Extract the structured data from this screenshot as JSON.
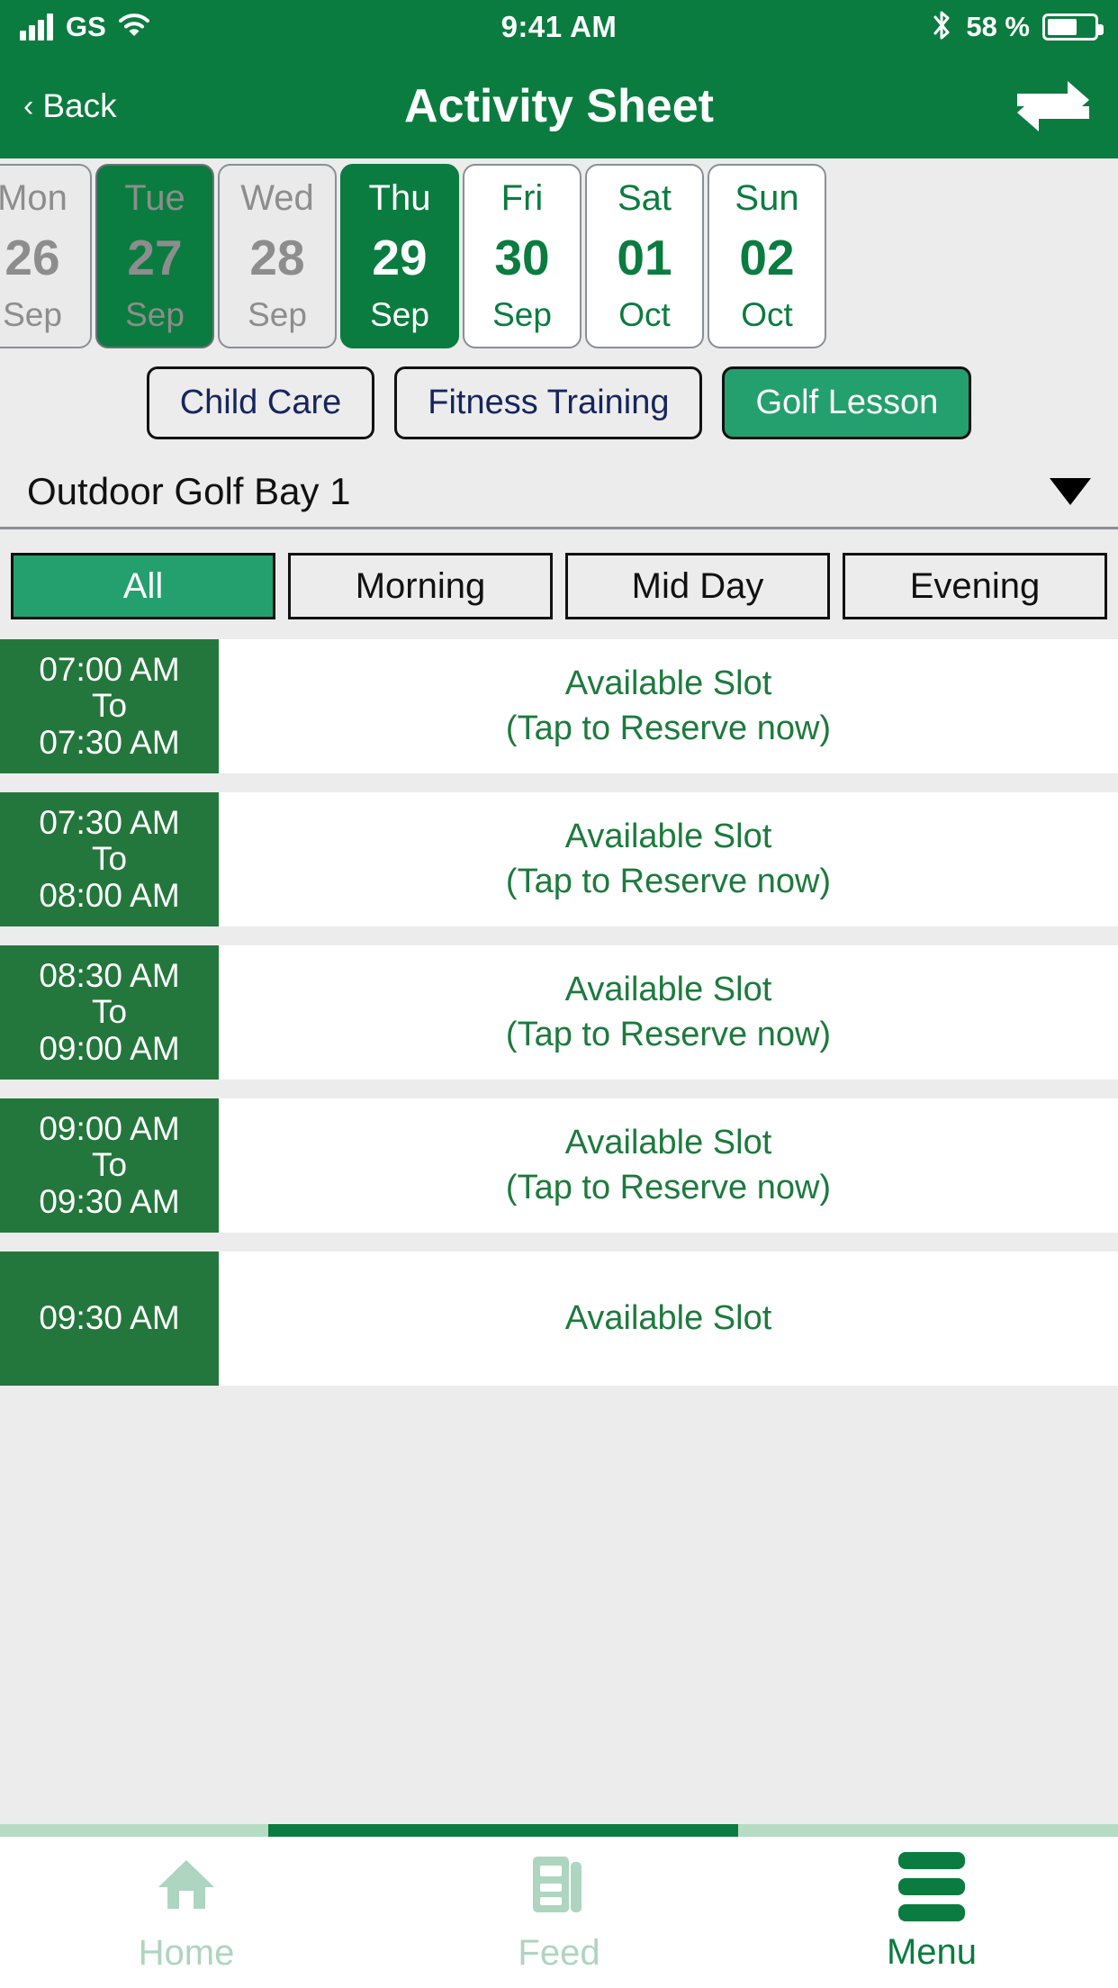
{
  "status_bar": {
    "carrier": "GS",
    "time": "9:41 AM",
    "battery_percent": "58 %",
    "signal_icon": "signal-bars-icon",
    "wifi_icon": "wifi-icon",
    "bluetooth_icon": "bluetooth-icon",
    "battery_icon": "battery-icon"
  },
  "header": {
    "back_label": "Back",
    "title": "Activity Sheet",
    "action_icon": "swap-arrows-icon"
  },
  "dates": [
    {
      "dow": "Mon",
      "day": "26",
      "mon": "Sep",
      "state": "past"
    },
    {
      "dow": "Tue",
      "day": "27",
      "mon": "Sep",
      "state": "past-highlight"
    },
    {
      "dow": "Wed",
      "day": "28",
      "mon": "Sep",
      "state": "past"
    },
    {
      "dow": "Thu",
      "day": "29",
      "mon": "Sep",
      "state": "selected"
    },
    {
      "dow": "Fri",
      "day": "30",
      "mon": "Sep",
      "state": "future"
    },
    {
      "dow": "Sat",
      "day": "01",
      "mon": "Oct",
      "state": "future"
    },
    {
      "dow": "Sun",
      "day": "02",
      "mon": "Oct",
      "state": "future"
    }
  ],
  "activity_types": [
    {
      "label": "Child Care",
      "selected": false
    },
    {
      "label": "Fitness Training",
      "selected": false
    },
    {
      "label": "Golf Lesson",
      "selected": true
    }
  ],
  "location": {
    "selected": "Outdoor Golf Bay 1",
    "caret_icon": "chevron-down-icon"
  },
  "time_filters": [
    {
      "label": "All",
      "selected": true
    },
    {
      "label": "Morning",
      "selected": false
    },
    {
      "label": "Mid Day",
      "selected": false
    },
    {
      "label": "Evening",
      "selected": false
    }
  ],
  "slots": [
    {
      "start": "07:00 AM",
      "sep": "To",
      "end": "07:30 AM",
      "status": "Available Slot",
      "hint": "(Tap to Reserve now)"
    },
    {
      "start": "07:30 AM",
      "sep": "To",
      "end": "08:00 AM",
      "status": "Available Slot",
      "hint": "(Tap to Reserve now)"
    },
    {
      "start": "08:30 AM",
      "sep": "To",
      "end": "09:00 AM",
      "status": "Available Slot",
      "hint": "(Tap to Reserve now)"
    },
    {
      "start": "09:00 AM",
      "sep": "To",
      "end": "09:30 AM",
      "status": "Available Slot",
      "hint": "(Tap to Reserve now)"
    },
    {
      "start": "09:30 AM",
      "sep": "",
      "end": "",
      "status": "Available Slot",
      "hint": ""
    }
  ],
  "bottom_nav": [
    {
      "label": "Home",
      "icon": "home-icon",
      "active": false
    },
    {
      "label": "Feed",
      "icon": "feed-icon",
      "active": false
    },
    {
      "label": "Menu",
      "icon": "hamburger-menu-icon",
      "active": true
    }
  ],
  "colors": {
    "brand_green": "#0a7c3f",
    "slot_green": "#24773c",
    "accent_teal": "#23a06e",
    "page_bg": "#ececec",
    "chip_text": "#16255c",
    "muted_gray": "#8d8d8d"
  }
}
